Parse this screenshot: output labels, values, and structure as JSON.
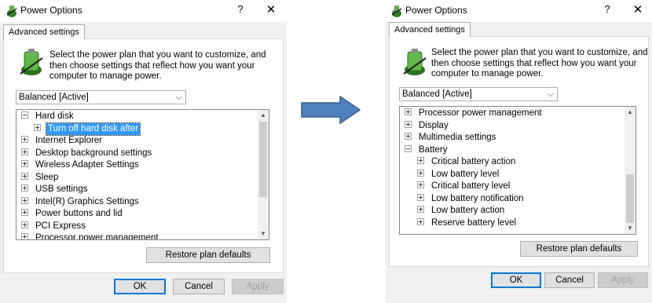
{
  "colors": {
    "arrow_fill": "#4f81bd",
    "arrow_stroke": "#385d8a",
    "selection": "#3399ff",
    "default_button_border": "#0078d7"
  },
  "left_dialog": {
    "title": "Power Options",
    "help_glyph": "?",
    "close_glyph": "✕",
    "tab": "Advanced settings",
    "description": [
      "Select the power plan that you want to customize, and",
      "then choose settings that reflect how you want your",
      "computer to manage power."
    ],
    "plan_select": "Balanced [Active]",
    "tree_items": [
      {
        "label": "Hard disk",
        "expander": "minus",
        "indent": 0
      },
      {
        "label": "Turn off hard disk after",
        "expander": "plus",
        "indent": 1,
        "selected": true
      },
      {
        "label": "Internet Explorer",
        "expander": "plus",
        "indent": 0
      },
      {
        "label": "Desktop background settings",
        "expander": "plus",
        "indent": 0
      },
      {
        "label": "Wireless Adapter Settings",
        "expander": "plus",
        "indent": 0
      },
      {
        "label": "Sleep",
        "expander": "plus",
        "indent": 0
      },
      {
        "label": "USB settings",
        "expander": "plus",
        "indent": 0
      },
      {
        "label": "Intel(R) Graphics Settings",
        "expander": "plus",
        "indent": 0
      },
      {
        "label": "Power buttons and lid",
        "expander": "plus",
        "indent": 0
      },
      {
        "label": "PCI Express",
        "expander": "plus",
        "indent": 0
      },
      {
        "label": "Processor power management",
        "expander": "plus",
        "indent": 0
      }
    ],
    "restore_button": "Restore plan defaults",
    "ok_button": "OK",
    "cancel_button": "Cancel",
    "apply_button": "Apply"
  },
  "right_dialog": {
    "title": "Power Options",
    "help_glyph": "?",
    "close_glyph": "✕",
    "tab": "Advanced settings",
    "description": [
      "Select the power plan that you want to customize, and",
      "then choose settings that reflect how you want your",
      "computer to manage power."
    ],
    "plan_select": "Balanced [Active]",
    "tree_items": [
      {
        "label": "Processor power management",
        "expander": "plus",
        "indent": 0
      },
      {
        "label": "Display",
        "expander": "plus",
        "indent": 0
      },
      {
        "label": "Multimedia settings",
        "expander": "plus",
        "indent": 0
      },
      {
        "label": "Battery",
        "expander": "minus",
        "indent": 0
      },
      {
        "label": "Critical battery action",
        "expander": "plus",
        "indent": 1
      },
      {
        "label": "Low battery level",
        "expander": "plus",
        "indent": 1
      },
      {
        "label": "Critical battery level",
        "expander": "plus",
        "indent": 1
      },
      {
        "label": "Low battery notification",
        "expander": "plus",
        "indent": 1
      },
      {
        "label": "Low battery action",
        "expander": "plus",
        "indent": 1
      },
      {
        "label": "Reserve battery level",
        "expander": "plus",
        "indent": 1
      }
    ],
    "restore_button": "Restore plan defaults",
    "ok_button": "OK",
    "cancel_button": "Cancel",
    "apply_button": "Apply"
  }
}
